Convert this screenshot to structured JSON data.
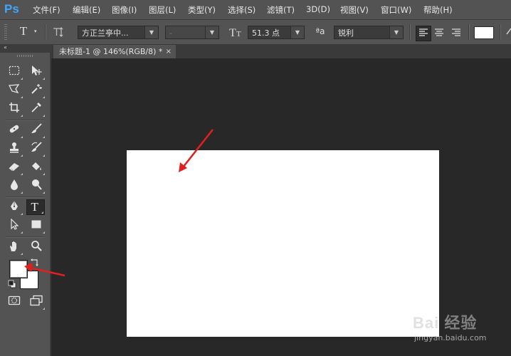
{
  "app": {
    "logo": "Ps"
  },
  "menu": [
    "文件(F)",
    "编辑(E)",
    "图像(I)",
    "图层(L)",
    "类型(Y)",
    "选择(S)",
    "滤镜(T)",
    "3D(D)",
    "视图(V)",
    "窗口(W)",
    "帮助(H)"
  ],
  "options": {
    "type_tool_glyph": "T",
    "font_family": "方正兰亭中...",
    "font_style": "-",
    "font_size": "51.3 点",
    "antialias_glyph": "ªa",
    "antialias": "锐利",
    "text_color": "#ffffff"
  },
  "document": {
    "tab_title": "未标题-1 @ 146%(RGB/8) *",
    "close_glyph": "×",
    "canvas_color": "#ffffff"
  },
  "toolbox": {
    "collapse_glyph": "«",
    "foreground_color": "#ffffff",
    "background_color": "#ffffff",
    "active_tool": "type-tool"
  },
  "annotations": {
    "arrow_color": "#e0201e"
  },
  "watermark": {
    "brand": "Bai 经验",
    "site": "jingyan.baidu.com"
  }
}
